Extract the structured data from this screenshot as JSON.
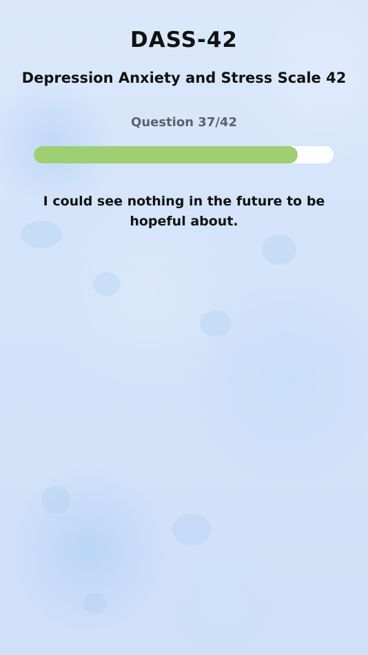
{
  "header": {
    "title": "DASS-42",
    "subtitle": "Depression Anxiety and Stress Scale 42"
  },
  "progress": {
    "label": "Question 37/42",
    "fraction": 0.881
  },
  "question": {
    "text": "I could see nothing in the future to be hopeful about."
  },
  "colors": {
    "progress_fill": "#9ecf72",
    "progress_track": "#ffffff",
    "background": "#d6e6fb"
  }
}
